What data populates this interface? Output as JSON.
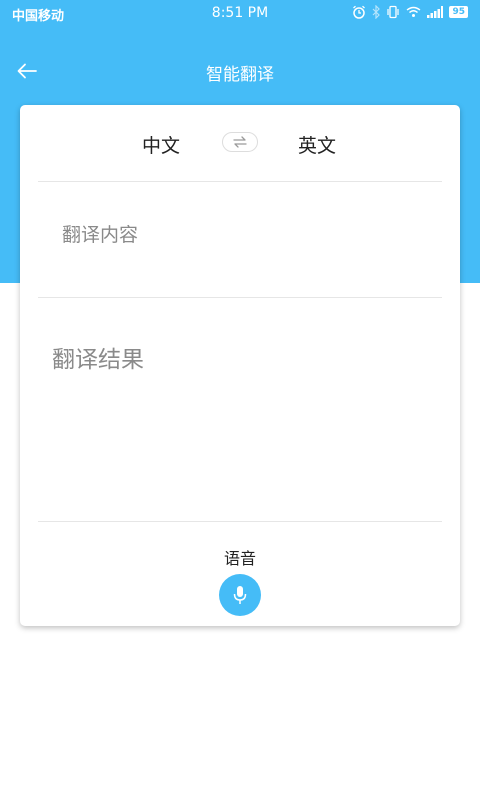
{
  "status_bar": {
    "carrier": "中国移动",
    "time": "8:51 PM",
    "battery": "95"
  },
  "app_bar": {
    "title": "智能翻译",
    "back_icon": "arrow-left-icon"
  },
  "languages": {
    "source": "中文",
    "target": "英文",
    "swap_icon": "swap-arrows-icon"
  },
  "input": {
    "placeholder": "翻译内容",
    "value": ""
  },
  "result": {
    "text": "翻译结果"
  },
  "voice": {
    "label": "语音",
    "icon": "microphone-icon"
  },
  "colors": {
    "primary": "#45bcf7",
    "text_dark": "#222222",
    "text_muted": "#8a8a8a",
    "divider": "#e6e6e6"
  }
}
